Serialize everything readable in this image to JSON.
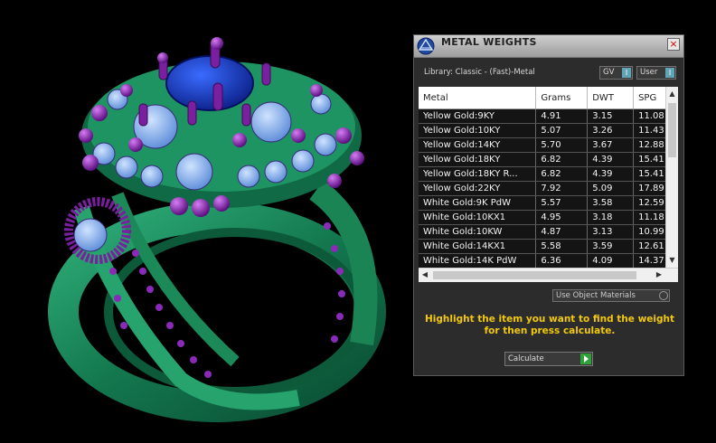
{
  "window": {
    "title": "METAL WEIGHTS",
    "close_label": "×"
  },
  "library": {
    "label": "Library: Classic - (Fast)-Metal",
    "toggle_gv": "GV",
    "toggle_user": "User",
    "knob": "I"
  },
  "table": {
    "columns": [
      "Metal",
      "Grams",
      "DWT",
      "SPG"
    ],
    "rows": [
      {
        "metal": "Yellow Gold:9KY",
        "grams": "4.91",
        "dwt": "3.15",
        "spg": "11.08"
      },
      {
        "metal": "Yellow Gold:10KY",
        "grams": "5.07",
        "dwt": "3.26",
        "spg": "11.43"
      },
      {
        "metal": "Yellow Gold:14KY",
        "grams": "5.70",
        "dwt": "3.67",
        "spg": "12.88"
      },
      {
        "metal": "Yellow Gold:18KY",
        "grams": "6.82",
        "dwt": "4.39",
        "spg": "15.41"
      },
      {
        "metal": "Yellow Gold:18KY R...",
        "grams": "6.82",
        "dwt": "4.39",
        "spg": "15.41"
      },
      {
        "metal": "Yellow Gold:22KY",
        "grams": "7.92",
        "dwt": "5.09",
        "spg": "17.89"
      },
      {
        "metal": "White Gold:9K PdW",
        "grams": "5.57",
        "dwt": "3.58",
        "spg": "12.59"
      },
      {
        "metal": "White Gold:10KX1",
        "grams": "4.95",
        "dwt": "3.18",
        "spg": "11.18"
      },
      {
        "metal": "White Gold:10KW",
        "grams": "4.87",
        "dwt": "3.13",
        "spg": "10.99"
      },
      {
        "metal": "White Gold:14KX1",
        "grams": "5.58",
        "dwt": "3.59",
        "spg": "12.61"
      },
      {
        "metal": "White Gold:14K PdW",
        "grams": "6.36",
        "dwt": "4.09",
        "spg": "14.37"
      }
    ]
  },
  "dropdown": {
    "selected": "Use Object Materials"
  },
  "instructions": {
    "line1": "Highlight the item you want to find the weight",
    "line2": "for then press calculate."
  },
  "calculate": {
    "label": "Calculate"
  },
  "colors": {
    "instruction_text": "#f2c80f",
    "metal_green": "#1e8a5c",
    "prong_purple": "#7a1fa0",
    "stone_blue": "#6aa8f0",
    "center_stone": "#1030b0"
  }
}
